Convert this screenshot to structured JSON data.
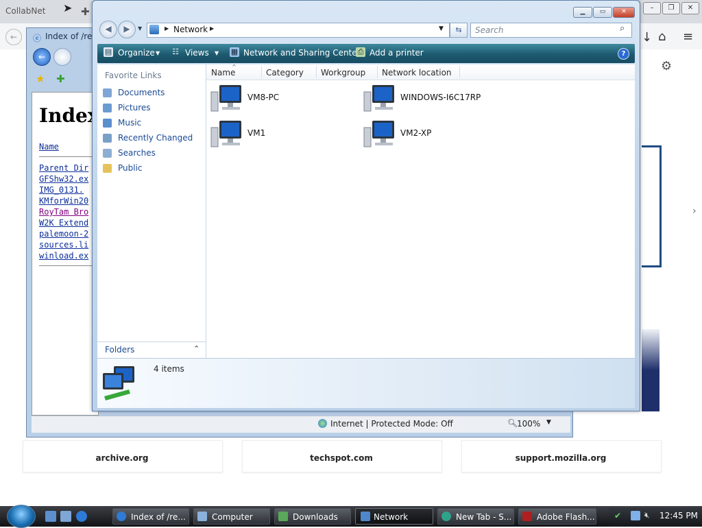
{
  "background_browser": {
    "tab_title": "CollabNet",
    "settings_icon": "gear-icon",
    "home_icon": "home-icon",
    "menu_icon": "hamburger-icon",
    "tiles": [
      "archive.org",
      "techspot.com",
      "support.mozilla.org"
    ]
  },
  "ie_window": {
    "tab_title": "Index of /rep",
    "page_heading": "Index",
    "name_header": "Name",
    "links": [
      "Parent Dir",
      "GFShw32.ex",
      "IMG_0131.",
      "KMforWin20",
      "RoyTam Bro",
      "W2K Extend",
      "palemoon-2",
      "sources.li",
      "winload.ex"
    ],
    "status_text": "Internet | Protected Mode: Off",
    "zoom": "100%"
  },
  "explorer": {
    "address": "Network",
    "search_placeholder": "Search",
    "toolbar": {
      "organize": "Organize",
      "views": "Views",
      "network_sharing": "Network and Sharing Center",
      "add_printer": "Add a printer"
    },
    "nav": {
      "favorite_links_header": "Favorite Links",
      "items": [
        "Documents",
        "Pictures",
        "Music",
        "Recently Changed",
        "Searches",
        "Public"
      ],
      "folders_label": "Folders"
    },
    "columns": [
      "Name",
      "Category",
      "Workgroup",
      "Network location"
    ],
    "computers": [
      "VM8-PC",
      "WINDOWS-I6C17RP",
      "VM1",
      "VM2-XP"
    ],
    "details": {
      "count": "4 items"
    }
  },
  "taskbar": {
    "buttons": [
      "Index of /re...",
      "Computer",
      "Downloads",
      "Network",
      "New Tab - S...",
      "Adobe Flash..."
    ],
    "active": "Network",
    "clock": "12:45 PM"
  }
}
